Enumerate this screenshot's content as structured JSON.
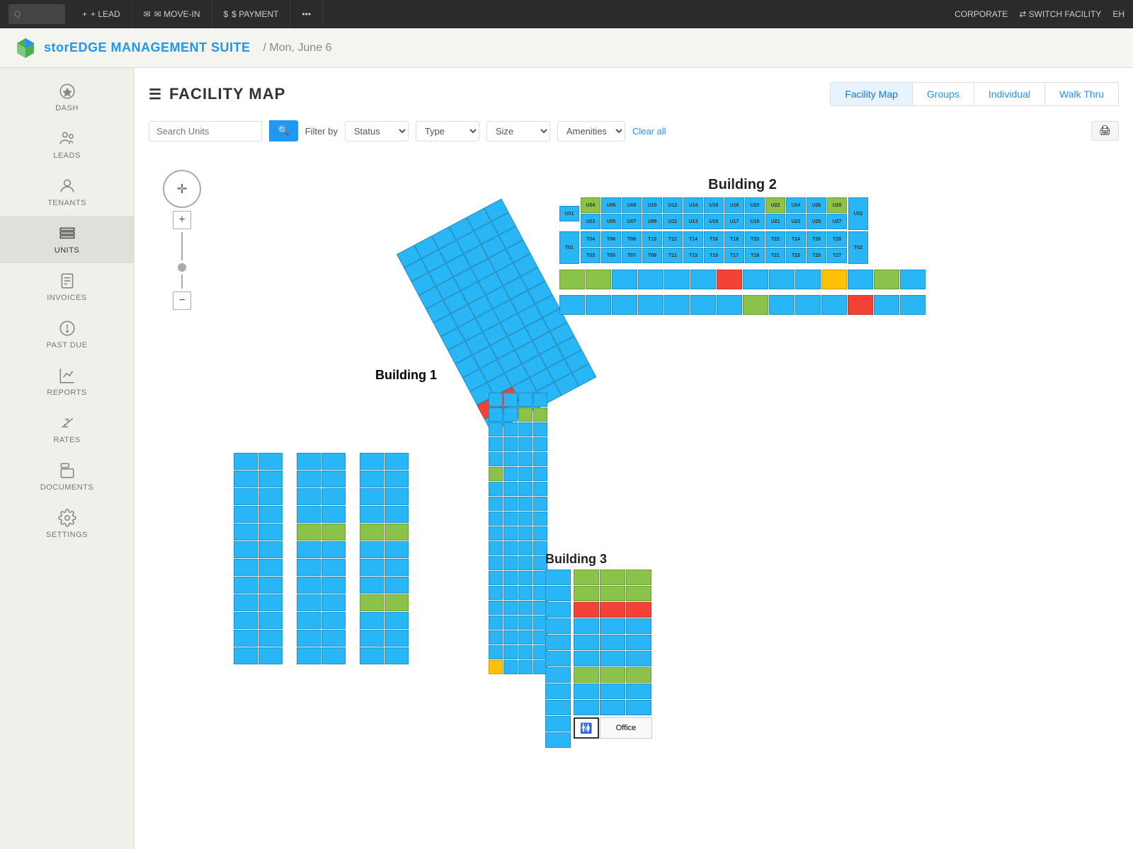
{
  "topNav": {
    "searchPlaceholder": "Q",
    "items": [
      {
        "label": "+ LEAD",
        "icon": "plus-icon"
      },
      {
        "label": "✉ MOVE-IN",
        "icon": "movein-icon"
      },
      {
        "label": "$ PAYMENT",
        "icon": "payment-icon"
      },
      {
        "label": "•••",
        "icon": "more-icon"
      }
    ],
    "right": [
      {
        "label": "CORPORATE"
      },
      {
        "label": "⇄ SWITCH FACILITY"
      },
      {
        "label": "EH"
      }
    ]
  },
  "appHeader": {
    "title": "storEDGE MANAGEMENT SUITE",
    "date": "/ Mon, June 6"
  },
  "sidebar": {
    "items": [
      {
        "label": "DASH",
        "icon": "dash-icon"
      },
      {
        "label": "LEADS",
        "icon": "leads-icon"
      },
      {
        "label": "TENANTS",
        "icon": "tenants-icon"
      },
      {
        "label": "UNITS",
        "icon": "units-icon",
        "active": true
      },
      {
        "label": "INVOICES",
        "icon": "invoices-icon"
      },
      {
        "label": "PAST DUE",
        "icon": "pastdue-icon"
      },
      {
        "label": "REPORTS",
        "icon": "reports-icon"
      },
      {
        "label": "RATES",
        "icon": "rates-icon"
      },
      {
        "label": "DOCUMENTS",
        "icon": "documents-icon"
      },
      {
        "label": "SETTINGS",
        "icon": "settings-icon"
      }
    ]
  },
  "page": {
    "title": "FACILITY MAP",
    "tabs": [
      {
        "label": "Facility Map",
        "active": true
      },
      {
        "label": "Groups"
      },
      {
        "label": "Individual"
      },
      {
        "label": "Walk Thru"
      }
    ]
  },
  "filterBar": {
    "searchPlaceholder": "Search Units",
    "filterLabel": "Filter by",
    "statusLabel": "Status",
    "typeLabel": "Type",
    "sizeLabel": "Size",
    "amenitiesLabel": "Amenities",
    "clearAll": "Clear all",
    "printTitle": "Print"
  },
  "buildings": {
    "building2": {
      "label": "Building 2",
      "row1": [
        "U04",
        "U06",
        "U08",
        "U10",
        "U12",
        "U14",
        "U16",
        "U18",
        "U20",
        "U22",
        "U24",
        "U26",
        "U28",
        "U02"
      ],
      "row2": [
        "U03",
        "U05",
        "U07",
        "U09",
        "U11",
        "U13",
        "U15",
        "U17",
        "U19",
        "U21",
        "U23",
        "U25",
        "U27"
      ],
      "row3": [
        "T04",
        "T06",
        "T08",
        "T10",
        "T12",
        "T14",
        "T16",
        "T18",
        "T20",
        "T22",
        "T24",
        "T26",
        "T28",
        "T02"
      ],
      "row4": [
        "T01",
        "T03",
        "T05",
        "T07",
        "T09",
        "T11",
        "T13",
        "T15",
        "T17",
        "T19",
        "T21",
        "T23",
        "T25",
        "T27"
      ]
    },
    "building3": {
      "label": "Building 3",
      "officeLabel": "Office"
    }
  }
}
